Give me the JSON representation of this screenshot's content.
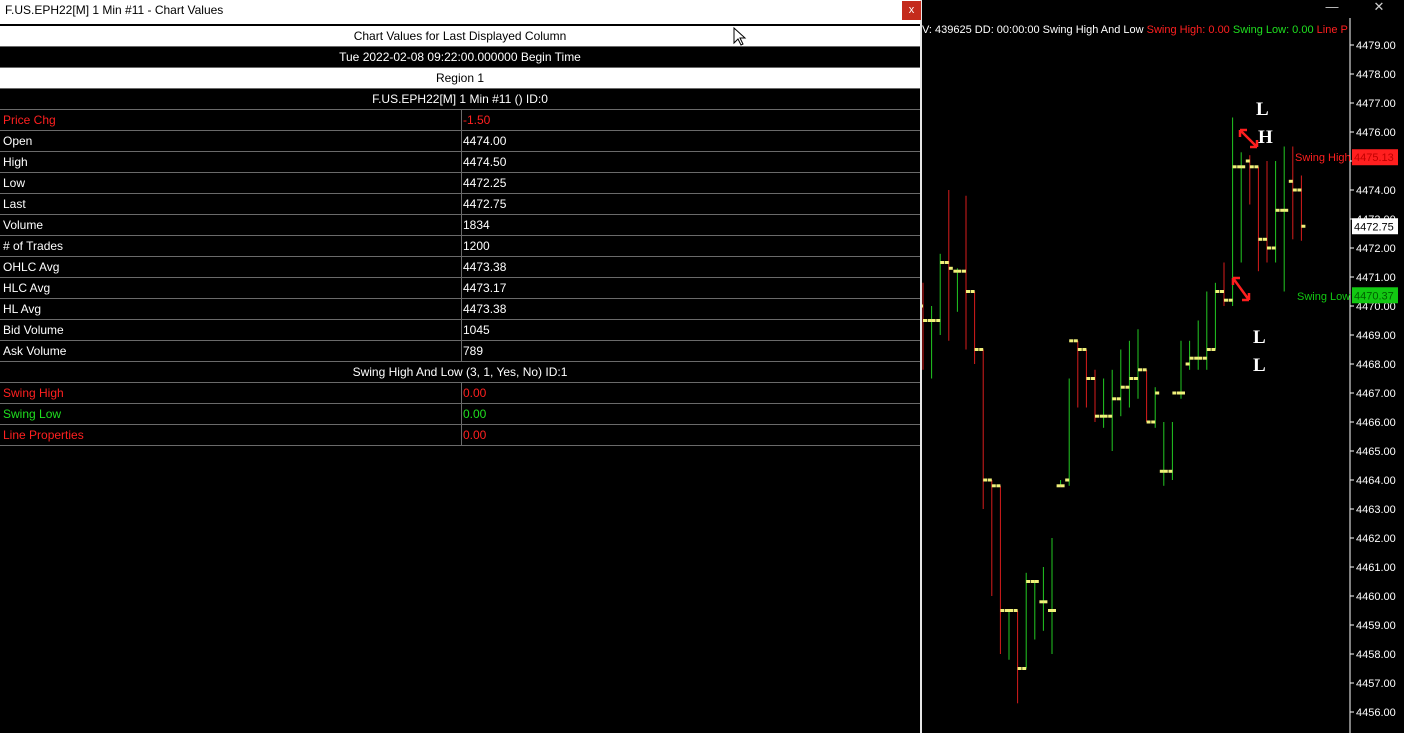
{
  "window": {
    "title": "F.US.EPH22[M]  1 Min   #11 - Chart Values",
    "close_label": "x"
  },
  "table": {
    "heading": "Chart Values for Last Displayed Column",
    "datetime": "Tue 2022-02-08  09:22:00.000000 Begin Time",
    "region": "Region 1",
    "symbol_line": "F.US.EPH22[M]  1 Min   #11 ()   ID:0",
    "rows": [
      {
        "label": "Price Chg",
        "value": "-1.50",
        "color": "red"
      },
      {
        "label": "Open",
        "value": "4474.00",
        "color": "white"
      },
      {
        "label": "High",
        "value": "4474.50",
        "color": "white"
      },
      {
        "label": "Low",
        "value": "4472.25",
        "color": "white"
      },
      {
        "label": "Last",
        "value": "4472.75",
        "color": "white"
      },
      {
        "label": "Volume",
        "value": "1834",
        "color": "white"
      },
      {
        "label": "# of Trades",
        "value": "1200",
        "color": "white"
      },
      {
        "label": "OHLC Avg",
        "value": "4473.38",
        "color": "white"
      },
      {
        "label": "HLC Avg",
        "value": "4473.17",
        "color": "white"
      },
      {
        "label": "HL Avg",
        "value": "4473.38",
        "color": "white"
      },
      {
        "label": "Bid Volume",
        "value": "1045",
        "color": "white"
      },
      {
        "label": "Ask Volume",
        "value": "789",
        "color": "white"
      }
    ],
    "study_line": "Swing High And Low (3, 1, Yes, No)    ID:1",
    "study_rows": [
      {
        "label": "Swing High",
        "value": "0.00",
        "color": "red"
      },
      {
        "label": "Swing Low",
        "value": "0.00",
        "color": "green"
      },
      {
        "label": "Line Properties",
        "value": "0.00",
        "color": "red"
      }
    ]
  },
  "chart": {
    "study_text_prefix": "V: 439625 DD: 00:00:00 Swing High And Low",
    "swing_high_text": "Swing High: 0.00",
    "swing_low_text": "Swing Low: 0.00",
    "line_text": "Line P",
    "window_buttons": {
      "minimize": "—",
      "maximize": "☐",
      "close": "✕"
    },
    "annotations": {
      "top_letter_1": "L",
      "top_letter_2": "H",
      "bottom_letter_1": "L",
      "bottom_letter_2": "L",
      "swing_high_label": "Swing High",
      "swing_low_label": "Swing Low"
    },
    "colors": {
      "up": "#22c822",
      "down": "#d81c1c",
      "bar_tick": "#f0f07a",
      "swing_high": "#ff1f1f",
      "swing_low": "#12c812"
    },
    "axis_ticks": [
      4479.0,
      4478.0,
      4477.0,
      4476.0,
      4475.0,
      4474.0,
      4473.0,
      4472.0,
      4471.0,
      4470.0,
      4469.0,
      4468.0,
      4467.0,
      4466.0,
      4465.0,
      4464.0,
      4463.0,
      4462.0,
      4461.0,
      4460.0,
      4459.0,
      4458.0,
      4457.0,
      4456.0
    ],
    "price_tags": {
      "swing_high": "4475.13",
      "last": "4472.75",
      "swing_low": "4470.37"
    }
  },
  "chart_data": {
    "type": "ohlc",
    "ylim": [
      4455.6,
      4479.5
    ],
    "bars": [
      {
        "o": 4470.0,
        "h": 4470.8,
        "l": 4467.8,
        "c": 4469.5
      },
      {
        "o": 4469.5,
        "h": 4470.0,
        "l": 4467.5,
        "c": 4469.5
      },
      {
        "o": 4469.5,
        "h": 4471.8,
        "l": 4469.0,
        "c": 4471.5
      },
      {
        "o": 4471.5,
        "h": 4474.0,
        "l": 4468.8,
        "c": 4471.3
      },
      {
        "o": 4471.2,
        "h": 4471.3,
        "l": 4469.8,
        "c": 4471.2
      },
      {
        "o": 4471.2,
        "h": 4473.8,
        "l": 4468.5,
        "c": 4470.5
      },
      {
        "o": 4470.5,
        "h": 4470.5,
        "l": 4468.0,
        "c": 4468.5
      },
      {
        "o": 4468.5,
        "h": 4468.5,
        "l": 4463.0,
        "c": 4464.0
      },
      {
        "o": 4464.0,
        "h": 4464.0,
        "l": 4460.0,
        "c": 4463.8
      },
      {
        "o": 4463.8,
        "h": 4463.8,
        "l": 4458.0,
        "c": 4459.5
      },
      {
        "o": 4459.5,
        "h": 4459.5,
        "l": 4457.8,
        "c": 4459.5
      },
      {
        "o": 4459.5,
        "h": 4459.5,
        "l": 4456.3,
        "c": 4457.5
      },
      {
        "o": 4457.5,
        "h": 4460.8,
        "l": 4457.5,
        "c": 4460.5
      },
      {
        "o": 4460.5,
        "h": 4460.5,
        "l": 4458.5,
        "c": 4460.5
      },
      {
        "o": 4459.8,
        "h": 4461.0,
        "l": 4458.8,
        "c": 4459.8
      },
      {
        "o": 4459.5,
        "h": 4462.0,
        "l": 4458.0,
        "c": 4459.5
      },
      {
        "o": 4463.8,
        "h": 4464.0,
        "l": 4463.8,
        "c": 4463.8
      },
      {
        "o": 4464.0,
        "h": 4467.5,
        "l": 4463.8,
        "c": 4468.8
      },
      {
        "o": 4468.8,
        "h": 4468.8,
        "l": 4466.5,
        "c": 4468.5
      },
      {
        "o": 4468.5,
        "h": 4468.5,
        "l": 4466.5,
        "c": 4467.5
      },
      {
        "o": 4467.5,
        "h": 4467.8,
        "l": 4466.0,
        "c": 4466.2
      },
      {
        "o": 4466.2,
        "h": 4467.5,
        "l": 4465.8,
        "c": 4466.2
      },
      {
        "o": 4466.2,
        "h": 4467.8,
        "l": 4465.0,
        "c": 4466.8
      },
      {
        "o": 4466.8,
        "h": 4468.5,
        "l": 4466.2,
        "c": 4467.2
      },
      {
        "o": 4467.2,
        "h": 4468.8,
        "l": 4466.5,
        "c": 4467.5
      },
      {
        "o": 4467.5,
        "h": 4469.2,
        "l": 4466.8,
        "c": 4467.8
      },
      {
        "o": 4467.8,
        "h": 4467.8,
        "l": 4466.0,
        "c": 4466.0
      },
      {
        "o": 4466.0,
        "h": 4467.2,
        "l": 4465.8,
        "c": 4467.0
      },
      {
        "o": 4464.3,
        "h": 4466.0,
        "l": 4463.8,
        "c": 4464.3
      },
      {
        "o": 4464.3,
        "h": 4466.0,
        "l": 4464.0,
        "c": 4467.0
      },
      {
        "o": 4467.0,
        "h": 4468.8,
        "l": 4466.8,
        "c": 4467.0
      },
      {
        "o": 4468.0,
        "h": 4468.8,
        "l": 4467.8,
        "c": 4468.2
      },
      {
        "o": 4468.2,
        "h": 4469.5,
        "l": 4467.8,
        "c": 4468.2
      },
      {
        "o": 4468.2,
        "h": 4470.5,
        "l": 4467.8,
        "c": 4468.5
      },
      {
        "o": 4468.5,
        "h": 4470.8,
        "l": 4468.5,
        "c": 4470.5
      },
      {
        "o": 4470.5,
        "h": 4471.5,
        "l": 4470.0,
        "c": 4470.2
      },
      {
        "o": 4470.2,
        "h": 4476.5,
        "l": 4470.0,
        "c": 4474.8
      },
      {
        "o": 4474.8,
        "h": 4475.3,
        "l": 4471.5,
        "c": 4474.8
      },
      {
        "o": 4475.0,
        "h": 4475.2,
        "l": 4473.5,
        "c": 4474.8
      },
      {
        "o": 4474.8,
        "h": 4474.8,
        "l": 4471.2,
        "c": 4472.3
      },
      {
        "o": 4472.3,
        "h": 4475.0,
        "l": 4471.5,
        "c": 4472.0
      },
      {
        "o": 4472.0,
        "h": 4475.0,
        "l": 4471.5,
        "c": 4473.3
      },
      {
        "o": 4473.3,
        "h": 4475.5,
        "l": 4470.5,
        "c": 4473.3
      },
      {
        "o": 4474.3,
        "h": 4475.5,
        "l": 4472.3,
        "c": 4474.0
      },
      {
        "o": 4474.0,
        "h": 4474.5,
        "l": 4472.25,
        "c": 4472.75
      }
    ]
  }
}
